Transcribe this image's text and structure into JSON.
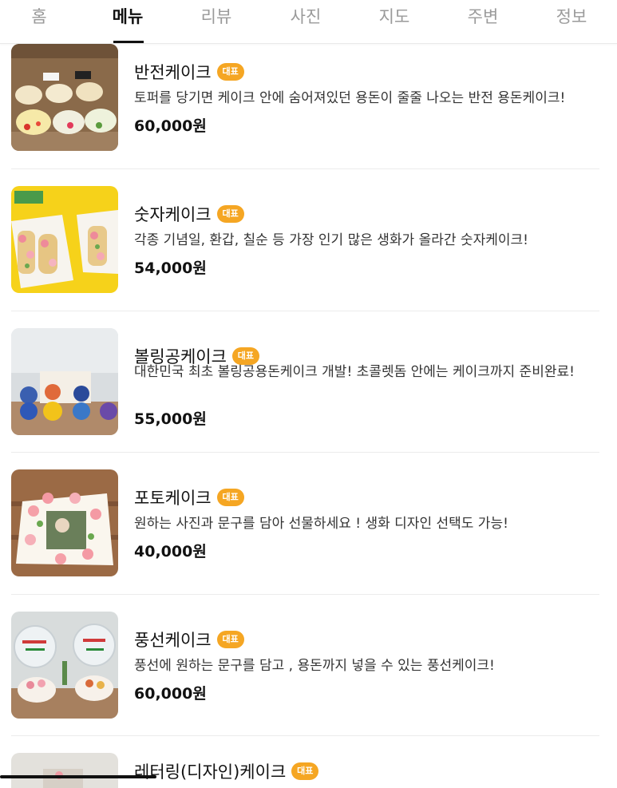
{
  "tabs": [
    {
      "label": "홈",
      "active": false
    },
    {
      "label": "메뉴",
      "active": true
    },
    {
      "label": "리뷰",
      "active": false
    },
    {
      "label": "사진",
      "active": false
    },
    {
      "label": "지도",
      "active": false
    },
    {
      "label": "주변",
      "active": false
    },
    {
      "label": "정보",
      "active": false
    }
  ],
  "badge_label": "대표",
  "colors": {
    "badge": "#f5a623",
    "active_tab": "#111111",
    "inactive_tab": "#9a9a9a"
  },
  "menu": [
    {
      "name": "반전케이크",
      "desc": "토퍼를 당기면 케이크 안에 숨어져있던 용돈이 줄줄 나오는 반전 용돈케이크!",
      "price": "60,000원"
    },
    {
      "name": "숫자케이크",
      "desc": "각종 기념일, 환갑, 칠순 등 가장 인기 많은 생화가 올라간 숫자케이크!",
      "price": "54,000원"
    },
    {
      "name": "볼링공케이크",
      "desc": "대한민국 최초 볼링공용돈케이크 개발! 초콜렛돔 안에는 케이크까지 준비완료!",
      "price": "55,000원"
    },
    {
      "name": "포토케이크",
      "desc": "원하는 사진과 문구를 담아 선물하세요 ! 생화 디자인 선택도 가능!",
      "price": "40,000원"
    },
    {
      "name": "풍선케이크",
      "desc": "풍선에 원하는 문구를 담고 , 용돈까지 넣을 수 있는 풍선케이크!",
      "price": "60,000원"
    },
    {
      "name": "레터링(디자인)케이크",
      "desc": "",
      "price": ""
    }
  ]
}
